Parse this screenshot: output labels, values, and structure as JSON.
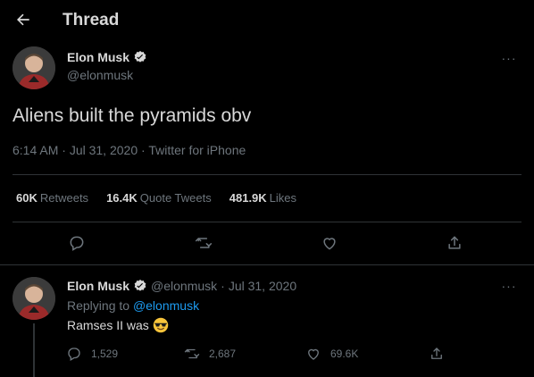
{
  "header": {
    "title": "Thread",
    "back_icon": "arrow-left-icon"
  },
  "tweet": {
    "author_name": "Elon Musk",
    "author_handle": "@elonmusk",
    "text": "Aliens built the pyramids obv",
    "time": "6:14 AM",
    "date": "Jul 31, 2020",
    "source": "Twitter for iPhone",
    "meta_sep": "·",
    "stats": {
      "retweets_value": "60K",
      "retweets_label": "Retweets",
      "quotes_value": "16.4K",
      "quotes_label": "Quote Tweets",
      "likes_value": "481.9K",
      "likes_label": "Likes"
    },
    "more": "···"
  },
  "reply": {
    "author_name": "Elon Musk",
    "author_handle": "@elonmusk",
    "sep": "·",
    "date": "Jul 31, 2020",
    "replying_prefix": "Replying to",
    "replying_handle": "@elonmusk",
    "text": "Ramses II was",
    "emoji": "smiling-face-with-sunglasses",
    "more": "···",
    "counts": {
      "replies": "1,529",
      "retweets": "2,687",
      "likes": "69.6K"
    }
  },
  "colors": {
    "background": "#000000",
    "text": "#d9d9d9",
    "secondary": "#6e767d",
    "link": "#1d9bf0",
    "divider": "#2f3336"
  }
}
